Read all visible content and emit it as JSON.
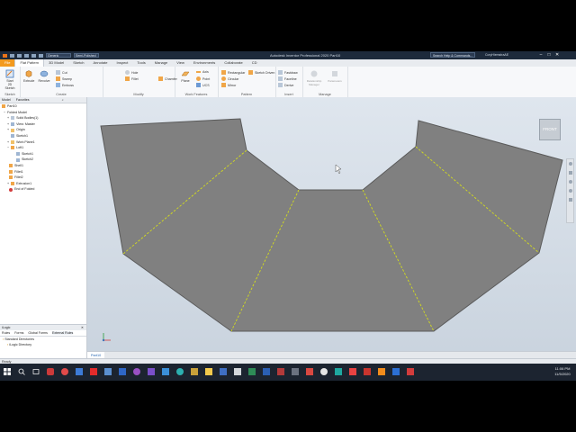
{
  "titlebar": {
    "appearance_dropdown": "Generic",
    "material_dropdown": "Semi-Polished",
    "title": "Autodesk Inventor Professional 2020   Part10",
    "search_placeholder": "Search Help & Commands...",
    "user": "CoryHiemstraAE",
    "window_controls": [
      "–",
      "□",
      "✕"
    ]
  },
  "tabs": [
    "File",
    "Flat Pattern",
    "3D Model",
    "Sketch",
    "Annotate",
    "Inspect",
    "Tools",
    "Manage",
    "View",
    "Environments",
    "Collaborate",
    "CD"
  ],
  "active_tab": "Flat Pattern",
  "ribbon": {
    "sketch_panel": {
      "start_label": "Start",
      "start_label2": "2D Sketch",
      "panel_label": "Sketch"
    },
    "create_panel": {
      "tools": [
        "Cut",
        "Sweep",
        "Emboss"
      ],
      "big_tools": [
        "Extrude",
        "Revolve"
      ],
      "panel_label": "Create"
    },
    "modify_panel": {
      "tools": [
        "Hole",
        "Fillet",
        "Chamfer"
      ],
      "panel_label": "Modify"
    },
    "work_panel": {
      "big_tool": "Plane",
      "tools": [
        "Axis",
        "Point",
        "UCS"
      ],
      "panel_label": "Work Features"
    },
    "pattern_panel": {
      "tools": [
        "Rectangular",
        "Circular",
        "Mirror"
      ],
      "panel_label": "Pattern"
    },
    "convert_panel": {
      "tools": [
        "Sketch Driven"
      ]
    },
    "freeform_panel": {
      "tools": [
        "Fastdraw",
        "Faceline",
        "Derive"
      ],
      "panel_label": "Insert"
    },
    "manage_panel": {
      "big_tools": [
        "Relationship Manager",
        "Parameters"
      ],
      "panel_label": "Manage"
    }
  },
  "browser": {
    "header_tabs": [
      "Model",
      "Favorites"
    ],
    "root": "Part10",
    "items": [
      "Folded Model",
      "Solid Bodies(1)",
      "View: Master",
      "Origin",
      "Sketch1",
      "Work Plane1",
      "Loft1",
      "Sketch1",
      "Sketch2",
      "Shell1",
      "Fillet1",
      "Fillet2",
      "Extrusion1",
      "End of Folded"
    ]
  },
  "ilogic": {
    "header": "iLogic",
    "tabs": [
      "Rules",
      "Forms",
      "Global Forms",
      "External Rules"
    ],
    "items": [
      "Standard Directories",
      "iLogic Directory"
    ]
  },
  "viewport": {
    "viewcube_label": "FRONT",
    "face_color": "#808080",
    "edge_color": "#d4dd1c"
  },
  "doc_tab": "Part10",
  "status_text": "Ready",
  "taskbar": {
    "time": "11:06 PM",
    "date": "11/5/2020"
  }
}
